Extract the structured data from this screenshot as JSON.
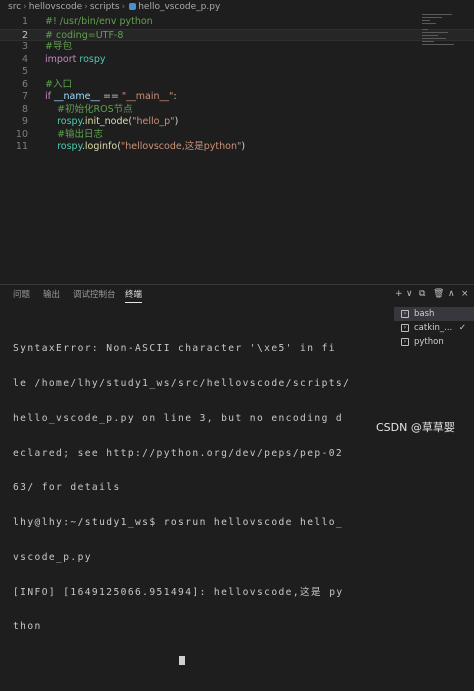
{
  "breadcrumb": {
    "parts": [
      "src",
      "hellovscode",
      "scripts",
      "hello_vscode_p.py"
    ]
  },
  "editor": {
    "current_line": 2,
    "lines": [
      {
        "n": "1",
        "segs": [
          {
            "t": "#! /usr/bin/env python",
            "c": "c-com"
          }
        ]
      },
      {
        "n": "2",
        "segs": [
          {
            "t": "# coding=UTF-8",
            "c": "c-com"
          }
        ]
      },
      {
        "n": "3",
        "segs": [
          {
            "t": "#导包",
            "c": "c-com"
          }
        ]
      },
      {
        "n": "4",
        "segs": [
          {
            "t": "import",
            "c": "c-kw"
          },
          {
            "t": " ",
            "c": "c-txt"
          },
          {
            "t": "rospy",
            "c": "c-mod"
          }
        ]
      },
      {
        "n": "5",
        "segs": []
      },
      {
        "n": "6",
        "segs": [
          {
            "t": "#入口",
            "c": "c-com"
          }
        ]
      },
      {
        "n": "7",
        "segs": [
          {
            "t": "if",
            "c": "c-kw"
          },
          {
            "t": " __name__",
            "c": "c-var"
          },
          {
            "t": " == ",
            "c": "c-op"
          },
          {
            "t": "\"__main__\"",
            "c": "c-str"
          },
          {
            "t": ":",
            "c": "c-txt"
          }
        ]
      },
      {
        "n": "8",
        "segs": [
          {
            "t": "    #初始化ROS节点",
            "c": "c-com"
          }
        ]
      },
      {
        "n": "9",
        "segs": [
          {
            "t": "    rospy",
            "c": "c-mod"
          },
          {
            "t": ".",
            "c": "c-txt"
          },
          {
            "t": "init_node",
            "c": "c-fn"
          },
          {
            "t": "(",
            "c": "c-txt"
          },
          {
            "t": "\"hello_p\"",
            "c": "c-str"
          },
          {
            "t": ")",
            "c": "c-txt"
          }
        ]
      },
      {
        "n": "10",
        "segs": [
          {
            "t": "    #输出日志",
            "c": "c-com"
          }
        ]
      },
      {
        "n": "11",
        "segs": [
          {
            "t": "    rospy",
            "c": "c-mod"
          },
          {
            "t": ".",
            "c": "c-txt"
          },
          {
            "t": "loginfo",
            "c": "c-fn"
          },
          {
            "t": "(",
            "c": "c-txt"
          },
          {
            "t": "\"hellovscode,这是python\"",
            "c": "c-str"
          },
          {
            "t": ")",
            "c": "c-txt"
          }
        ]
      }
    ]
  },
  "panel": {
    "tabs": [
      "问题",
      "输出",
      "调试控制台",
      "终端"
    ],
    "active_tab": 3,
    "toolbar": {
      "add": "+",
      "dropdown": "∨",
      "split": "⧉",
      "trash": "🗑",
      "up": "∧",
      "close": "×"
    },
    "terminals": [
      {
        "label": "bash",
        "selected": true,
        "check": ""
      },
      {
        "label": "catkin_...",
        "selected": false,
        "check": "✓"
      },
      {
        "label": "python",
        "selected": false,
        "check": ""
      }
    ],
    "terminal_lines": [
      "SyntaxError: Non-ASCII character '\\xe5' in fi",
      "le /home/lhy/study1_ws/src/hellovscode/scripts/",
      "hello_vscode_p.py on line 3, but no encoding d",
      "eclared; see http://python.org/dev/peps/pep-02",
      "63/ for details",
      "lhy@lhy:~/study1_ws$ rosrun hellovscode hello_",
      "vscode_p.py",
      "[INFO] [1649125066.951494]: hellovscode,这是 py",
      "thon"
    ]
  },
  "watermark": "CSDN @草草婴"
}
